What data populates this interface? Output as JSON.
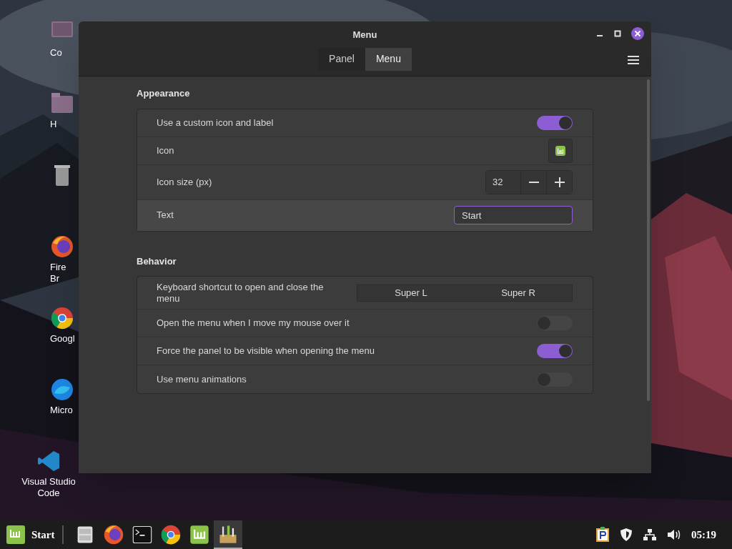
{
  "desktop_icons": [
    {
      "label": "Co",
      "kind": "computer"
    },
    {
      "label": "H",
      "kind": "home"
    },
    {
      "kind": "trash"
    },
    {
      "label": "Fire\nBr",
      "kind": "firefox"
    },
    {
      "label": "Googl",
      "kind": "chrome"
    },
    {
      "label": "Micro",
      "kind": "edge"
    },
    {
      "label": "Visual Studio\nCode",
      "kind": "vscode"
    }
  ],
  "window": {
    "title": "Menu",
    "tabs": [
      {
        "label": "Panel",
        "selected": false
      },
      {
        "label": "Menu",
        "selected": true
      }
    ]
  },
  "sections": [
    {
      "title": "Appearance",
      "rows": [
        {
          "kind": "switch",
          "label": "Use a custom icon and label",
          "on": true
        },
        {
          "kind": "icon",
          "label": "Icon"
        },
        {
          "kind": "spin",
          "label": "Icon size (px)",
          "value": "32"
        },
        {
          "kind": "entry",
          "label": "Text",
          "value": "Start"
        }
      ]
    },
    {
      "title": "Behavior",
      "rows": [
        {
          "kind": "shortcut",
          "label": "Keyboard shortcut to open and close the menu",
          "keys": [
            "Super L",
            "Super R"
          ]
        },
        {
          "kind": "switch",
          "label": "Open the menu when I move my mouse over it",
          "on": false
        },
        {
          "kind": "switch",
          "label": "Force the panel to be visible when opening the menu",
          "on": true
        },
        {
          "kind": "switch",
          "label": "Use menu animations",
          "on": false
        }
      ]
    }
  ],
  "taskbar": {
    "start_label": "Start",
    "apps": [
      {
        "kind": "files",
        "selected": false
      },
      {
        "kind": "firefox",
        "selected": false
      },
      {
        "kind": "terminal",
        "selected": false
      },
      {
        "kind": "chrome",
        "selected": false
      },
      {
        "kind": "mint",
        "selected": false
      },
      {
        "kind": "settings",
        "selected": true
      }
    ],
    "clock": "05:19"
  }
}
